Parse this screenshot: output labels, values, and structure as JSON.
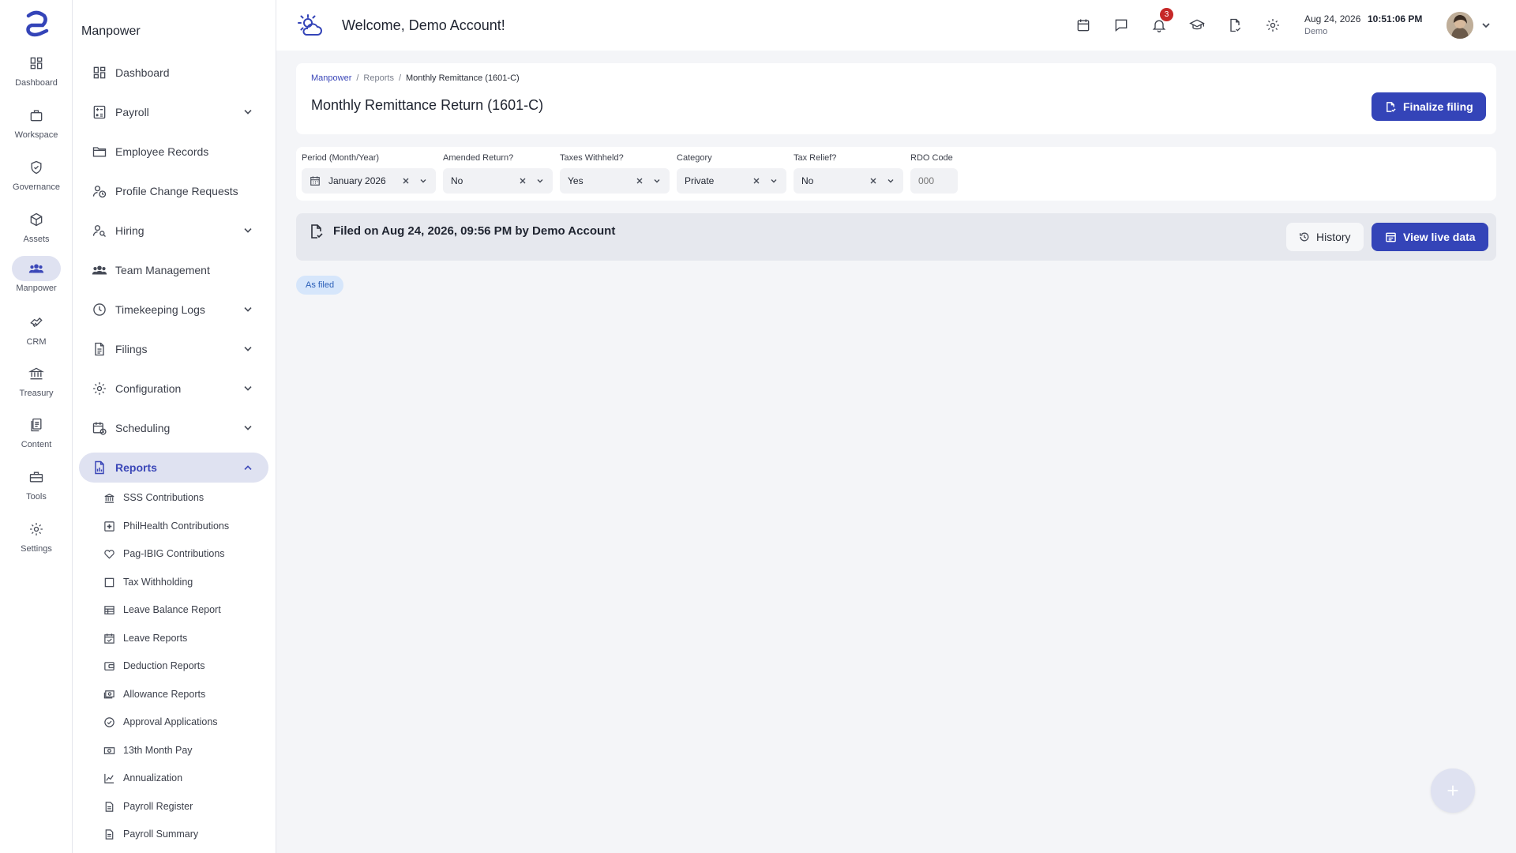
{
  "rail": {
    "items": [
      {
        "label": "Dashboard",
        "icon": "dashboard-icon"
      },
      {
        "label": "Workspace",
        "icon": "briefcase-icon"
      },
      {
        "label": "Governance",
        "icon": "shield-check-icon"
      },
      {
        "label": "Assets",
        "icon": "cube-icon"
      },
      {
        "label": "Manpower",
        "icon": "people-icon"
      },
      {
        "label": "CRM",
        "icon": "handshake-icon"
      },
      {
        "label": "Treasury",
        "icon": "bank-icon"
      },
      {
        "label": "Content",
        "icon": "document-icon"
      },
      {
        "label": "Tools",
        "icon": "toolbox-icon"
      },
      {
        "label": "Settings",
        "icon": "gear-icon"
      }
    ],
    "active": "Manpower"
  },
  "sidebar": {
    "title": "Manpower",
    "items": [
      {
        "label": "Dashboard"
      },
      {
        "label": "Payroll"
      },
      {
        "label": "Employee Records"
      },
      {
        "label": "Profile Change Requests"
      },
      {
        "label": "Hiring"
      },
      {
        "label": "Team Management"
      },
      {
        "label": "Timekeeping Logs"
      },
      {
        "label": "Filings"
      },
      {
        "label": "Configuration"
      },
      {
        "label": "Scheduling"
      },
      {
        "label": "Reports"
      }
    ],
    "sub_items": [
      {
        "label": "SSS Contributions"
      },
      {
        "label": "PhilHealth Contributions"
      },
      {
        "label": "Pag-IBIG Contributions"
      },
      {
        "label": "Tax Withholding"
      },
      {
        "label": "Leave Balance Report"
      },
      {
        "label": "Leave Reports"
      },
      {
        "label": "Deduction Reports"
      },
      {
        "label": "Allowance Reports"
      },
      {
        "label": "Approval Applications"
      },
      {
        "label": "13th Month Pay"
      },
      {
        "label": "Annualization"
      },
      {
        "label": "Payroll Register"
      },
      {
        "label": "Payroll Summary"
      }
    ]
  },
  "header": {
    "welcome": "Welcome, Demo Account!",
    "notification_count": "3",
    "date": "Aug 24, 2026",
    "time": "10:51:06 PM",
    "user": "Demo"
  },
  "page": {
    "breadcrumbs": [
      "Manpower",
      "Reports",
      "Monthly Remittance (1601-C)"
    ],
    "breadcrumb_sep": "/",
    "title": "Monthly Remittance Return (1601-C)",
    "finalize_label": "Finalize filing"
  },
  "filters": {
    "period": {
      "label": "Period (Month/Year)",
      "value": "January 2026"
    },
    "amended": {
      "label": "Amended Return?",
      "value": "No"
    },
    "taxes_withheld": {
      "label": "Taxes Withheld?",
      "value": "Yes"
    },
    "category": {
      "label": "Category",
      "value": "Private"
    },
    "tax_relief": {
      "label": "Tax Relief?",
      "value": "No"
    },
    "rdo": {
      "label": "RDO Code",
      "value": "",
      "placeholder": "000"
    }
  },
  "filed": {
    "text": "Filed on Aug 24, 2026, 09:56 PM by Demo Account",
    "history_label": "History",
    "live_label": "View live data",
    "chip": "As filed"
  },
  "colors": {
    "accent": "#3444b8",
    "active_bg": "#dfe2f1",
    "badge": "#c62828",
    "chip_bg": "#d6e6fb"
  }
}
